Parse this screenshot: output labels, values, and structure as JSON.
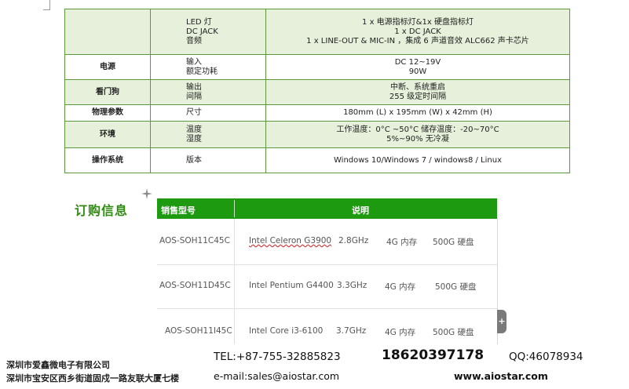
{
  "spec_table": {
    "rows": [
      {
        "category": "",
        "shade": "g",
        "subs": [
          "LED 灯",
          "DC JACK",
          "音频"
        ],
        "values": [
          "1 x 电源指标灯&1x 硬盘指标灯",
          "1 x DC JACK",
          "1 x LINE-OUT & MIC-IN ，集成 6 声道音效 ALC662 声卡芯片"
        ]
      },
      {
        "category": "电源",
        "shade": "w",
        "subs": [
          "输入",
          "额定功耗"
        ],
        "values": [
          "DC  12~19V",
          "90W"
        ]
      },
      {
        "category": "看门狗",
        "shade": "g",
        "subs": [
          "输出",
          "间隔"
        ],
        "values": [
          "中断、系统重启",
          "255 级定时间隔"
        ]
      },
      {
        "category": "物理参数",
        "shade": "w",
        "subs": [
          "尺寸"
        ],
        "values": [
          "180mm (L) x 195mm (W) x 42mm (H)"
        ]
      },
      {
        "category": "环境",
        "shade": "g",
        "subs": [
          "温度",
          "湿度"
        ],
        "values": [
          "工作温度：0°C ~50°C    储存温度：-20~70°C",
          "5%~90% 无冷凝"
        ]
      },
      {
        "category": "操作系统",
        "shade": "w",
        "subs": [
          "版本"
        ],
        "values": [
          "Windows 10/Windows 7 / windows8 / Linux"
        ]
      }
    ]
  },
  "order": {
    "title": "订购信息",
    "header": {
      "model": "销售型号",
      "description": "说明"
    },
    "rows": [
      {
        "model": "AOS-SOH11C45C",
        "cpu": "Intel Celeron G3900",
        "freq": "2.8GHz",
        "ram": "4G 内存",
        "disk": "500G 硬盘"
      },
      {
        "model": "AOS-SOH11D45C",
        "cpu": "Intel Pentium G4400",
        "freq": "3.3GHz",
        "ram": "4G 内存",
        "disk": "500G 硬盘"
      },
      {
        "model": "AOS-SOH11I45C",
        "cpu": "Intel Core i3-6100",
        "freq": "3.7GHz",
        "ram": "4G 内存",
        "disk": "500G 硬盘"
      }
    ],
    "expand_label": "+"
  },
  "footer": {
    "company": "深圳市爱鑫微电子有限公司",
    "address": "深圳市宝安区西乡街道固戍一路友联大厦七楼",
    "tel": "TEL:+87-755-32885823",
    "mobile": "18620397178",
    "qq": "QQ:46078934",
    "email": "e-mail:sales@aiostar.com",
    "web": "www.aiostar.com"
  },
  "colors": {
    "accent_green": "#1d9a0f",
    "title_green": "#2f8a12",
    "row_shade": "#e6f0da",
    "border_green": "#5a9a3a"
  }
}
